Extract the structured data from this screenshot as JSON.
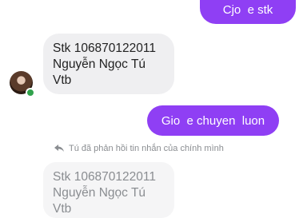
{
  "messages": {
    "sent_1": "Cjo  e stk",
    "received_1": {
      "lines": [
        "Stk 106870122011",
        "Nguyễn Ngọc Tú",
        "Vtb"
      ]
    },
    "sent_2": "Gio  e chuyen  luon",
    "reply_note": "Tú đã phản hồi tin nhắn của chính mình",
    "quoted": {
      "lines": [
        "Stk 106870122011",
        "Nguyễn Ngọc Tú",
        "Vtb"
      ]
    }
  },
  "colors": {
    "outgoing_bubble": "#8f3ff4",
    "incoming_bubble": "#efeff1",
    "presence_dot": "#31a24c"
  },
  "icons": {
    "reply": "reply-arrow-icon"
  }
}
